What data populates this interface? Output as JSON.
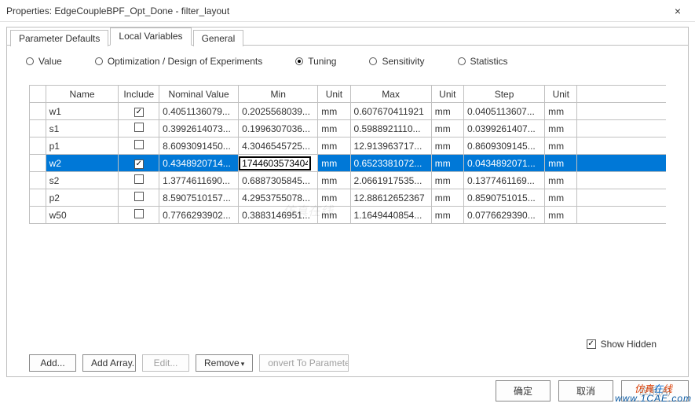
{
  "window": {
    "title": "Properties: EdgeCoupleBPF_Opt_Done - filter_layout",
    "close": "×"
  },
  "tabs": {
    "items": [
      {
        "label": "Parameter Defaults",
        "active": false
      },
      {
        "label": "Local Variables",
        "active": true
      },
      {
        "label": "General",
        "active": false
      }
    ]
  },
  "radios": {
    "items": [
      {
        "label": "Value",
        "checked": false
      },
      {
        "label": "Optimization / Design of Experiments",
        "checked": false
      },
      {
        "label": "Tuning",
        "checked": true
      },
      {
        "label": "Sensitivity",
        "checked": false
      },
      {
        "label": "Statistics",
        "checked": false
      }
    ]
  },
  "table": {
    "headers": {
      "name": "Name",
      "include": "Include",
      "nominal": "Nominal Value",
      "min": "Min",
      "unit": "Unit",
      "max": "Max",
      "unit2": "Unit",
      "step": "Step",
      "unit3": "Unit"
    },
    "rows": [
      {
        "name": "w1",
        "include": true,
        "nominal": "0.4051136079...",
        "min": "0.2025568039...",
        "unit": "mm",
        "max": "0.607670411921",
        "unit2": "mm",
        "step": "0.0405113607...",
        "unit3": "mm",
        "selected": false,
        "editing": false,
        "editValue": ""
      },
      {
        "name": "s1",
        "include": false,
        "nominal": "0.3992614073...",
        "min": "0.1996307036...",
        "unit": "mm",
        "max": "0.5988921110...",
        "unit2": "mm",
        "step": "0.0399261407...",
        "unit3": "mm",
        "selected": false,
        "editing": false,
        "editValue": ""
      },
      {
        "name": "p1",
        "include": false,
        "nominal": "8.6093091450...",
        "min": "4.3046545725...",
        "unit": "mm",
        "max": "12.913963717...",
        "unit2": "mm",
        "step": "0.8609309145...",
        "unit3": "mm",
        "selected": false,
        "editing": false,
        "editValue": ""
      },
      {
        "name": "w2",
        "include": true,
        "nominal": "0.4348920714...",
        "min": "1744603573404",
        "unit": "mm",
        "max": "0.6523381072...",
        "unit2": "mm",
        "step": "0.0434892071...",
        "unit3": "mm",
        "selected": true,
        "editing": true,
        "editValue": "1744603573404"
      },
      {
        "name": "s2",
        "include": false,
        "nominal": "1.3774611690...",
        "min": "0.6887305845...",
        "unit": "mm",
        "max": "2.0661917535...",
        "unit2": "mm",
        "step": "0.1377461169...",
        "unit3": "mm",
        "selected": false,
        "editing": false,
        "editValue": ""
      },
      {
        "name": "p2",
        "include": false,
        "nominal": "8.5907510157...",
        "min": "4.2953755078...",
        "unit": "mm",
        "max": "12.88612652367",
        "unit2": "mm",
        "step": "0.8590751015...",
        "unit3": "mm",
        "selected": false,
        "editing": false,
        "editValue": ""
      },
      {
        "name": "w50",
        "include": false,
        "nominal": "0.7766293902...",
        "min": "0.3883146951...",
        "unit": "mm",
        "max": "1.1649440854...",
        "unit2": "mm",
        "step": "0.0776629390...",
        "unit3": "mm",
        "selected": false,
        "editing": false,
        "editValue": ""
      }
    ]
  },
  "panel": {
    "show_hidden_label": "Show Hidden",
    "show_hidden_checked": true
  },
  "buttons": {
    "add": "Add...",
    "add_array": "Add Array...",
    "edit": "Edit...",
    "remove": "Remove",
    "convert": "onvert To Paramete"
  },
  "footer": {
    "ok": "确定",
    "cancel": "取消",
    "apply": "应用(A)"
  },
  "watermark": {
    "text1": "仿真在线"
  },
  "brand": {
    "line1a": "仿真",
    "line1b": "在",
    "line1c": "线",
    "line2": "www.1CAE.com"
  }
}
